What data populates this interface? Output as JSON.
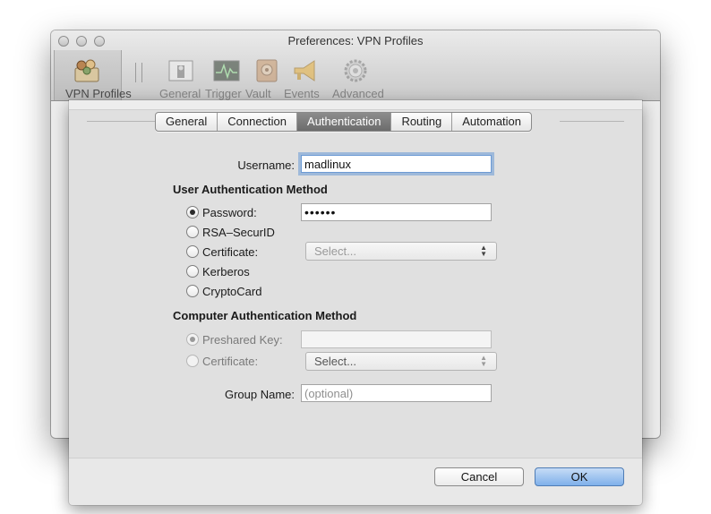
{
  "window": {
    "title": "Preferences: VPN Profiles",
    "toolbar": [
      {
        "label": "VPN Profiles",
        "icon": "vpn-profiles-icon"
      },
      {
        "label": "General",
        "icon": "general-icon"
      },
      {
        "label": "Trigger",
        "icon": "trigger-icon"
      },
      {
        "label": "Vault",
        "icon": "vault-icon"
      },
      {
        "label": "Events",
        "icon": "events-icon"
      },
      {
        "label": "Advanced",
        "icon": "advanced-gear-icon"
      }
    ]
  },
  "sheet": {
    "tabs": [
      "General",
      "Connection",
      "Authentication",
      "Routing",
      "Automation"
    ],
    "active_tab": "Authentication",
    "username": {
      "label": "Username:",
      "value": "madlinux"
    },
    "user_auth": {
      "title": "User Authentication Method",
      "password_label": "Password:",
      "password_value": "••••••",
      "rsa_label": "RSA–SecurID",
      "certificate_label": "Certificate:",
      "certificate_select": "Select...",
      "kerberos_label": "Kerberos",
      "cryptocard_label": "CryptoCard"
    },
    "computer_auth": {
      "title": "Computer Authentication Method",
      "preshared_label": "Preshared Key:",
      "certificate_label": "Certificate:",
      "certificate_select": "Select..."
    },
    "group": {
      "label": "Group Name:",
      "placeholder": "(optional)"
    },
    "buttons": {
      "cancel": "Cancel",
      "ok": "OK"
    }
  },
  "colors": {
    "accent": "#7fb0ea",
    "active_tab": "#7a7a7a",
    "focus_ring": "#6d9bd4"
  }
}
